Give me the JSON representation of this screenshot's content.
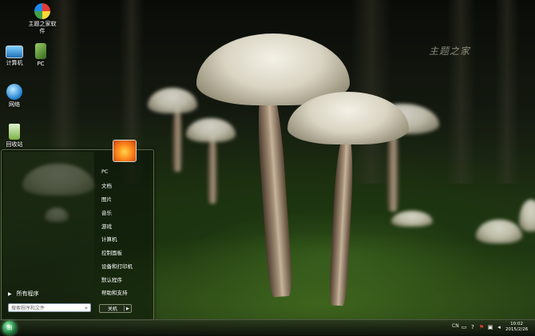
{
  "desktop": {
    "icons": [
      {
        "label": "主题之家软件",
        "icon": "theme-app-icon"
      },
      {
        "label": "计算机",
        "icon": "computer-icon"
      },
      {
        "label": "PC",
        "icon": "pc-icon"
      },
      {
        "label": "网络",
        "icon": "network-icon"
      },
      {
        "label": "回收站",
        "icon": "recycle-bin-icon"
      }
    ],
    "watermark": "主题之家"
  },
  "start_menu": {
    "right_items": [
      "PC",
      "文档",
      "图片",
      "音乐",
      "游戏",
      "计算机",
      "控制面板",
      "设备和打印机",
      "默认程序",
      "帮助和支持"
    ],
    "all_programs": "所有程序",
    "search_placeholder": "搜索程序和文件",
    "shutdown": "关机"
  },
  "taskbar": {
    "language": "CN",
    "time": "10:02",
    "date": "2015/2/26"
  }
}
